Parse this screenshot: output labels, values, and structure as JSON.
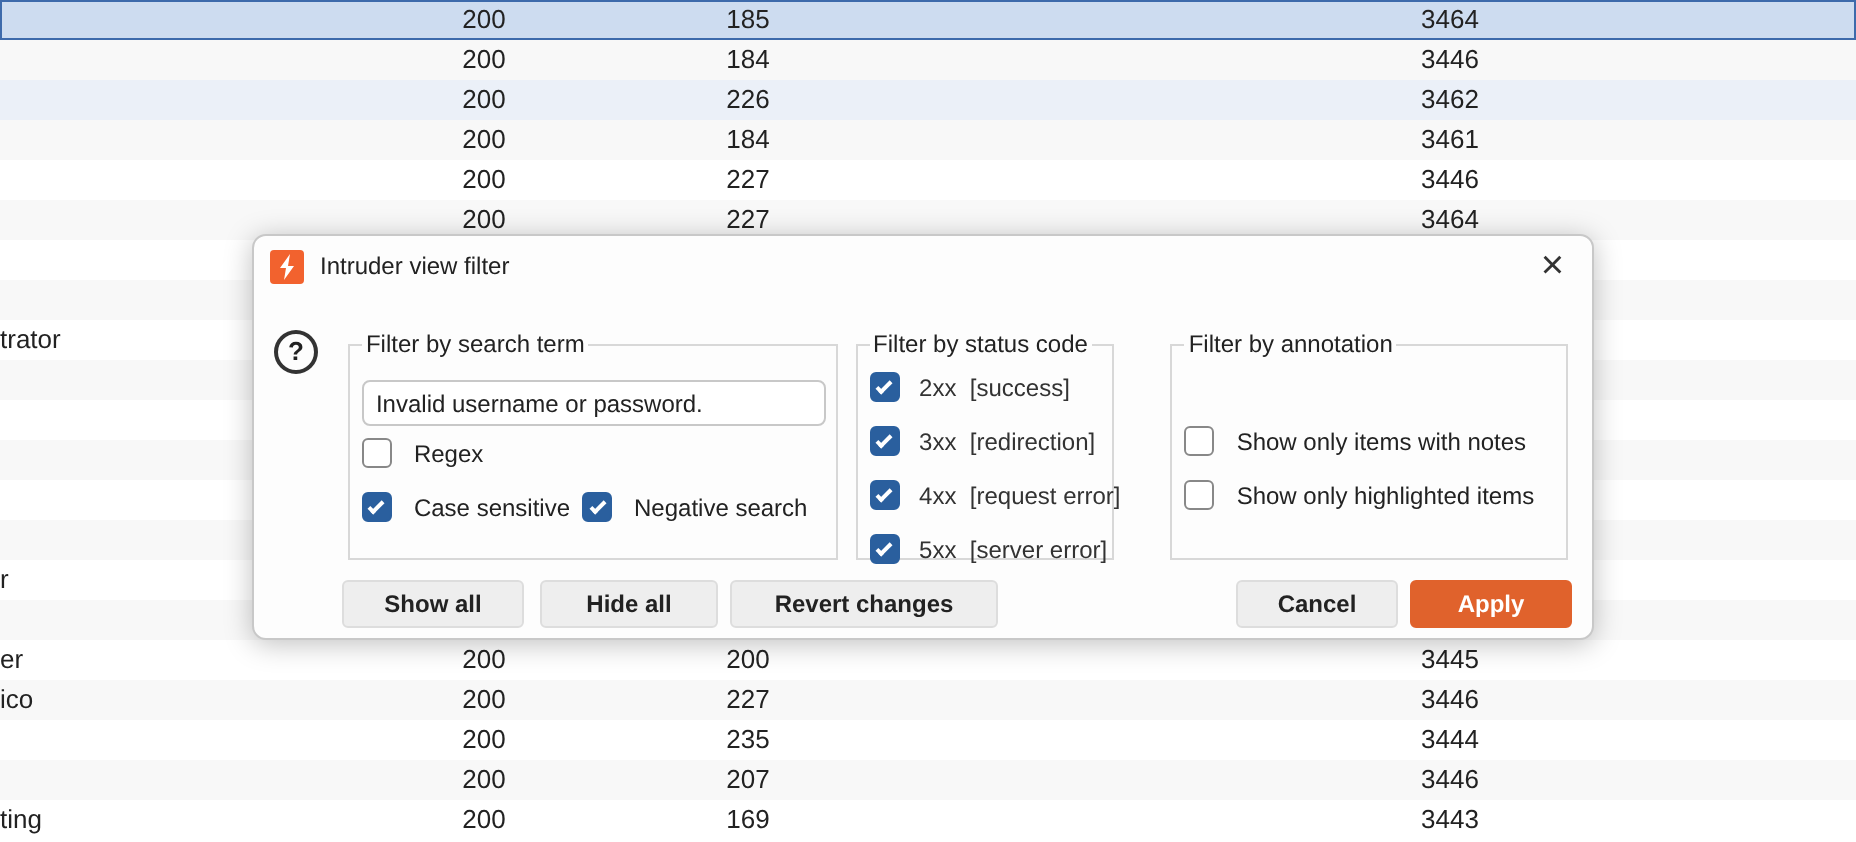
{
  "table": {
    "rows": [
      {
        "column_2": "200",
        "column_3": "185",
        "column_4": "3464",
        "selected": true,
        "hovered": false
      },
      {
        "column_2": "200",
        "column_3": "184",
        "column_4": "3446",
        "selected": false,
        "hovered": false
      },
      {
        "column_2": "200",
        "column_3": "226",
        "column_4": "3462",
        "selected": false,
        "hovered": true
      },
      {
        "column_2": "200",
        "column_3": "184",
        "column_4": "3461",
        "selected": false,
        "hovered": false
      },
      {
        "column_2": "200",
        "column_3": "227",
        "column_4": "3446",
        "selected": false,
        "hovered": false
      },
      {
        "column_2": "200",
        "column_3": "227",
        "column_4": "3464",
        "selected": false,
        "hovered": false
      },
      {},
      {},
      {
        "column_1": "trator"
      },
      {},
      {},
      {},
      {},
      {},
      {
        "column_1": "r"
      },
      {},
      {
        "column_1": "er",
        "column_2": "200",
        "column_3": "200",
        "column_4": "3445",
        "selected": false,
        "hovered": false
      },
      {
        "column_1": "ico",
        "column_2": "200",
        "column_3": "227",
        "column_4": "3446",
        "selected": false,
        "hovered": false
      },
      {
        "column_2": "200",
        "column_3": "235",
        "column_4": "3444",
        "selected": false,
        "hovered": false
      },
      {
        "column_2": "200",
        "column_3": "207",
        "column_4": "3446",
        "selected": false,
        "hovered": false
      },
      {
        "column_1": "ting",
        "column_2": "200",
        "column_3": "169",
        "column_4": "3443",
        "selected": false,
        "hovered": false
      }
    ]
  },
  "dialog": {
    "title": "Intruder view filter",
    "close": "×",
    "help": "?",
    "search_group": {
      "legend": "Filter by search term",
      "value": "Invalid username or password.",
      "options": [
        {
          "label": "Regex",
          "checked": false
        },
        {
          "label": "Case sensitive",
          "checked": true
        },
        {
          "label": "Negative search",
          "checked": true
        }
      ]
    },
    "status_group": {
      "legend": "Filter by status code",
      "options": [
        {
          "code": "2xx",
          "label": "[success]",
          "checked": true
        },
        {
          "code": "3xx",
          "label": "[redirection]",
          "checked": true
        },
        {
          "code": "4xx",
          "label": "[request error]",
          "checked": true
        },
        {
          "code": "5xx",
          "label": "[server error]",
          "checked": true
        }
      ]
    },
    "annotation_group": {
      "legend": "Filter by annotation",
      "options": [
        {
          "label": "Show only items with notes",
          "checked": false
        },
        {
          "label": "Show only highlighted items",
          "checked": false
        }
      ]
    },
    "buttons": [
      {
        "label": "Show all",
        "kind": "plain"
      },
      {
        "label": "Hide all",
        "kind": "plain"
      },
      {
        "label": "Revert changes",
        "kind": "plain"
      },
      {
        "label": "Cancel",
        "kind": "plain"
      },
      {
        "label": "Apply",
        "kind": "primary"
      }
    ]
  }
}
